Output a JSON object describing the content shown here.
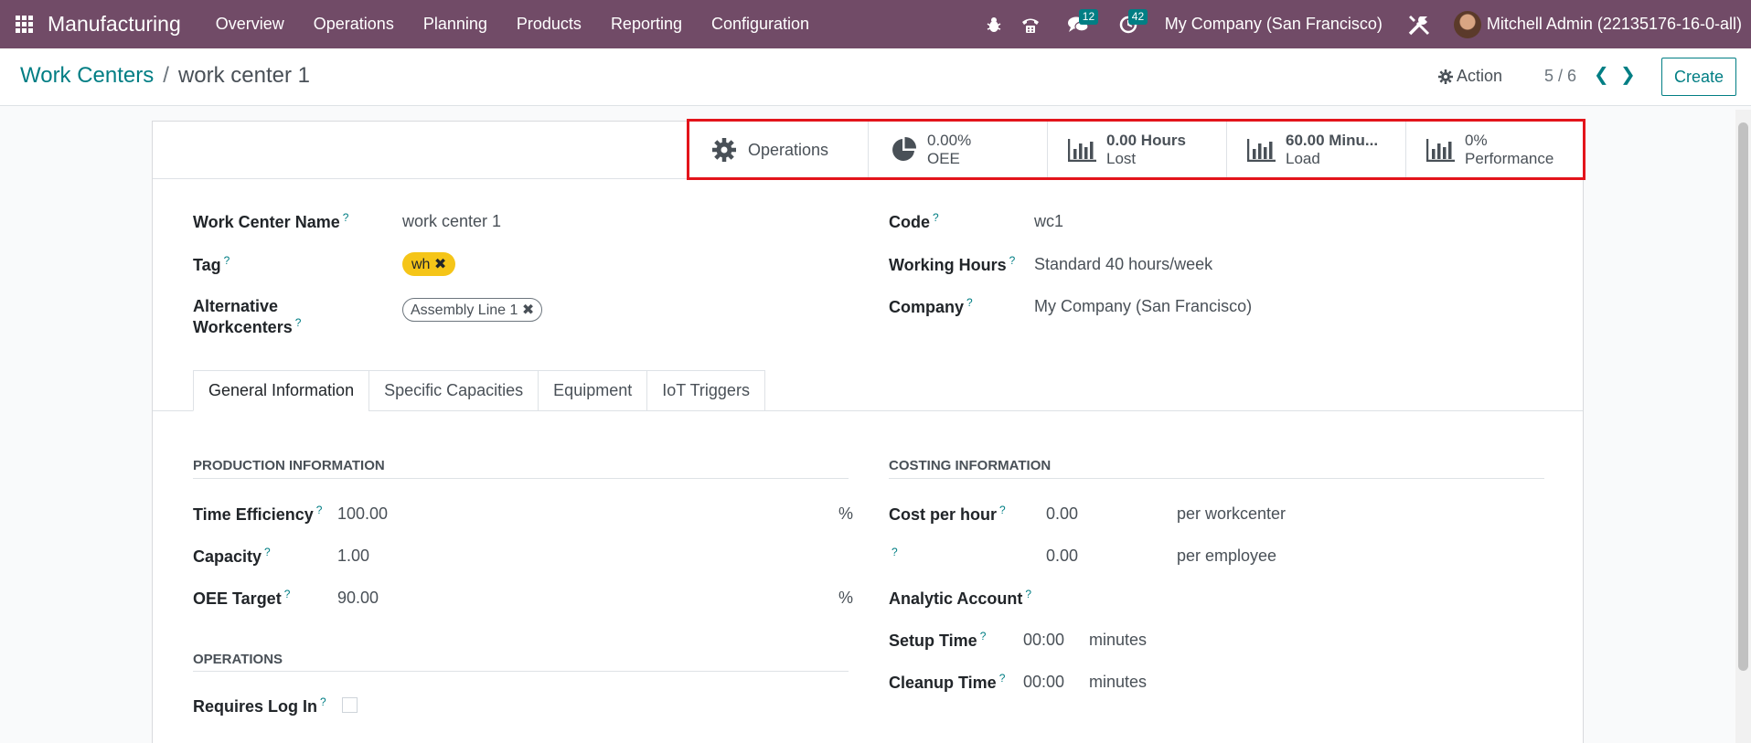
{
  "navbar": {
    "app_name": "Manufacturing",
    "menu": [
      "Overview",
      "Operations",
      "Planning",
      "Products",
      "Reporting",
      "Configuration"
    ],
    "messages_badge": "12",
    "activities_badge": "42",
    "company": "My Company (San Francisco)",
    "user": "Mitchell Admin (22135176-16-0-all)"
  },
  "control": {
    "breadcrumb_parent": "Work Centers",
    "breadcrumb_sep": "/",
    "breadcrumb_current": "work center 1",
    "action_label": "Action",
    "pager": "5 / 6",
    "create_label": "Create"
  },
  "stat_buttons": {
    "operations": "Operations",
    "oee_value": "0.00%",
    "oee_label": "OEE",
    "lost_value": "0.00 Hours",
    "lost_label": "Lost",
    "load_value": "60.00 Minu...",
    "load_label": "Load",
    "perf_value": "0%",
    "perf_label": "Performance"
  },
  "fields": {
    "name_label": "Work Center Name",
    "name_value": "work center 1",
    "tag_label": "Tag",
    "tag_value": "wh",
    "alt_label_1": "Alternative",
    "alt_label_2": "Workcenters",
    "alt_value": "Assembly Line 1",
    "code_label": "Code",
    "code_value": "wc1",
    "hours_label": "Working Hours",
    "hours_value": "Standard 40 hours/week",
    "company_label": "Company",
    "company_value": "My Company (San Francisco)"
  },
  "tabs": [
    "General Information",
    "Specific Capacities",
    "Equipment",
    "IoT Triggers"
  ],
  "production": {
    "title": "PRODUCTION INFORMATION",
    "eff_label": "Time Efficiency",
    "eff_value": "100.00",
    "eff_unit": "%",
    "cap_label": "Capacity",
    "cap_value": "1.00",
    "oee_label": "OEE Target",
    "oee_value": "90.00",
    "oee_unit": "%"
  },
  "operations": {
    "title": "OPERATIONS",
    "login_label": "Requires Log In"
  },
  "costing": {
    "title": "COSTING INFORMATION",
    "cost_label": "Cost per hour",
    "cost_value": "0.00",
    "cost_unit": "per workcenter",
    "emp_value": "0.00",
    "emp_unit": "per employee",
    "analytic_label": "Analytic Account",
    "setup_label": "Setup Time",
    "setup_value": "00:00",
    "setup_unit": "minutes",
    "cleanup_label": "Cleanup Time",
    "cleanup_value": "00:00",
    "cleanup_unit": "minutes"
  },
  "help_mark": "?",
  "colors": {
    "navbar": "#714b67",
    "accent": "#017e84",
    "highlight": "#e3141b",
    "tag": "#f5c518"
  }
}
